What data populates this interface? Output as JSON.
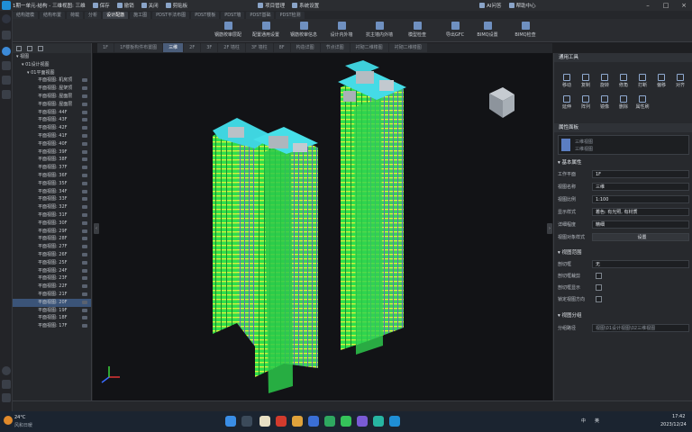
{
  "titlebar": {
    "title": "1期一单元-结构 - 三维视图: 三维",
    "buttons": [
      "保存",
      "撤销",
      "关闭",
      "剪贴板",
      "项目管理",
      "系统设置"
    ],
    "ai_label": "AI问答",
    "help_label": "帮助中心"
  },
  "menu_tabs": [
    "结构建模",
    "结构布置",
    "荷载",
    "分析",
    "设计配筋",
    "施工图",
    "PDST平法布图",
    "PDST楼板",
    "PDST墙",
    "PDST基础",
    "PDST检测"
  ],
  "active_menu_tab": "设计配筋",
  "ribbon": {
    "buttons": [
      "钢筋校审层配",
      "配置通用设置",
      "钢筋校审信息",
      "设计内外墙",
      "抗主墙内外墙",
      "模型检查",
      "导出GFC",
      "BIMQ设置",
      "BIMQ检查"
    ]
  },
  "view_tabs": [
    "1F",
    "1F楼板构件布置图",
    "三维",
    "2F",
    "3F",
    "2F 墙柱",
    "3F 墙柱",
    "8F",
    "构造详图",
    "节点详图",
    "衬砌二维楼图",
    "衬砌二维楼图"
  ],
  "active_view_tab": "三维",
  "tree": {
    "root": "视图",
    "group": "01设计视图",
    "subgroup": "01平面视图",
    "items": [
      "平面视图: 机房顶",
      "平面视图: 屋架顶",
      "平面视图: 屋面层",
      "平面视图: 屋面层",
      "平面视图: 44F",
      "平面视图: 43F",
      "平面视图: 42F",
      "平面视图: 41F",
      "平面视图: 40F",
      "平面视图: 39F",
      "平面视图: 38F",
      "平面视图: 37F",
      "平面视图: 36F",
      "平面视图: 35F",
      "平面视图: 34F",
      "平面视图: 33F",
      "平面视图: 32F",
      "平面视图: 31F",
      "平面视图: 30F",
      "平面视图: 29F",
      "平面视图: 28F",
      "平面视图: 27F",
      "平面视图: 26F",
      "平面视图: 25F",
      "平面视图: 24F",
      "平面视图: 23F",
      "平面视图: 22F",
      "平面视图: 21F",
      "平面视图: 20F",
      "平面视图: 19F",
      "平面视图: 18F",
      "平面视图: 17F"
    ]
  },
  "props": {
    "tools_header": "通用工具",
    "tools": [
      "移动",
      "复制",
      "旋转",
      "修角",
      "打断",
      "偏移",
      "对齐",
      "延伸",
      "阵列",
      "镜像",
      "删除",
      "属性刷",
      "删除",
      "属性刷"
    ],
    "property_header": "属性面板",
    "view_type_line1": "三维视图",
    "view_type_line2": "三维视图",
    "basic_section": "基本属性",
    "rows": [
      {
        "label": "工作平面",
        "value": "1F"
      },
      {
        "label": "视图名称",
        "value": "三维"
      },
      {
        "label": "视图比例",
        "value": "1:100"
      },
      {
        "label": "显示样式",
        "value": "着色: 有光照, 有材质"
      },
      {
        "label": "详细程度",
        "value": "精细"
      },
      {
        "label": "视图对象样式",
        "value": "设置"
      }
    ],
    "range_section": "视图范围",
    "range_rows": [
      {
        "label": "剖切框",
        "value": "无"
      },
      {
        "label": "剖切框裁剪",
        "value": ""
      },
      {
        "label": "剖切框显示",
        "value": ""
      },
      {
        "label": "锁定视图方向",
        "value": ""
      }
    ],
    "group_section": "视图分组",
    "group_row": {
      "label": "分组路径",
      "value": "视图\\01设计视图\\02三维视图"
    }
  },
  "taskbar": {
    "weather_temp": "24°C",
    "weather_desc": "风和日暖",
    "lang": "中",
    "ime": "英",
    "time": "17:42",
    "date": "2023/12/24"
  }
}
